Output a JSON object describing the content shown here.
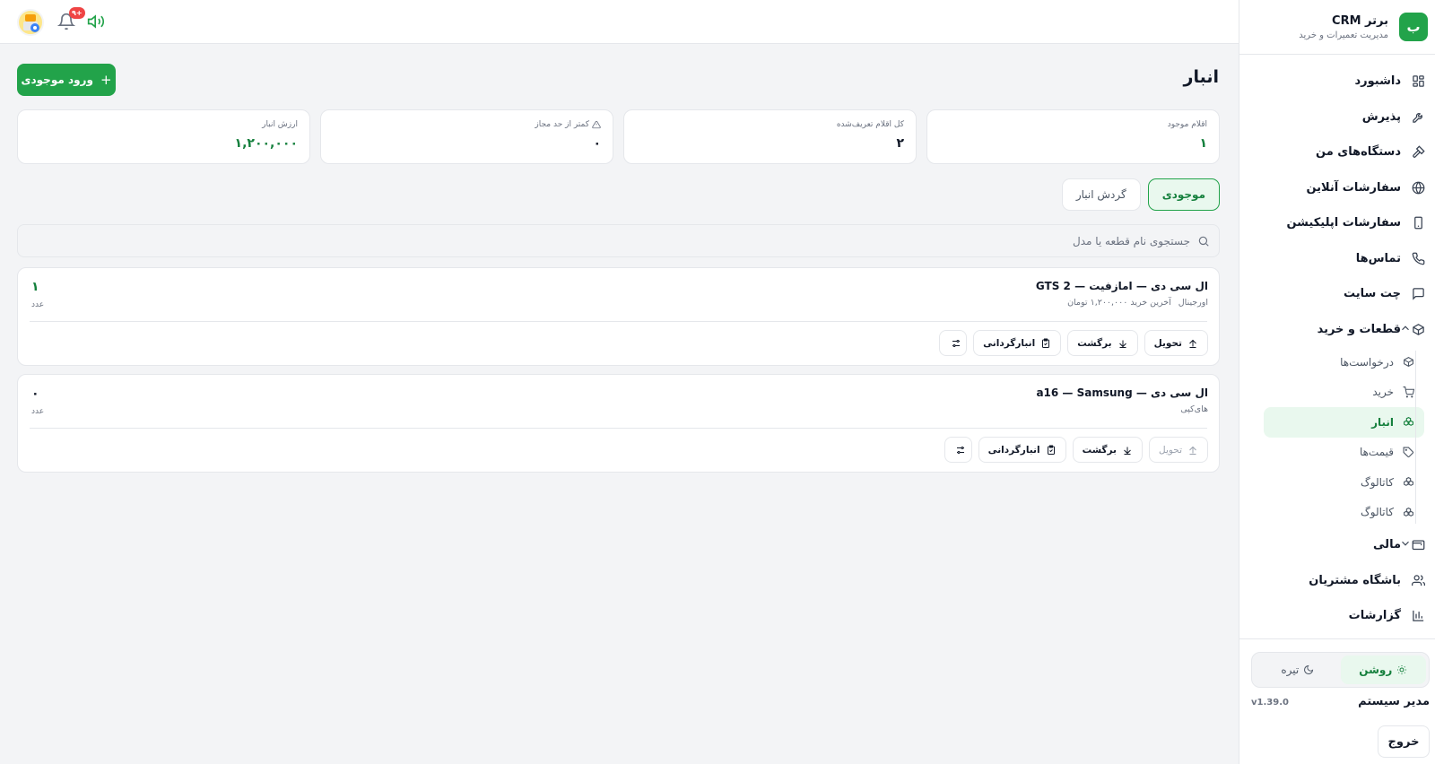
{
  "brand": {
    "logo_letter": "ب",
    "title": "برتر CRM",
    "subtitle": "مدیریت تعمیرات و خرید",
    "accent": "#22a34a"
  },
  "nav": {
    "items": [
      {
        "label": "داشبورد",
        "icon": "dashboard-icon"
      },
      {
        "label": "پذیرش",
        "icon": "wrench-icon"
      },
      {
        "label": "دستگاه‌های من",
        "icon": "hammer-icon"
      },
      {
        "label": "سفارشات آنلاین",
        "icon": "globe-icon"
      },
      {
        "label": "سفارشات اپلیکیشن",
        "icon": "smartphone-icon"
      },
      {
        "label": "تماس‌ها",
        "icon": "phone-icon"
      },
      {
        "label": "چت سایت",
        "icon": "chat-icon"
      },
      {
        "label": "قطعات و خرید",
        "icon": "package-icon",
        "expanded": true
      }
    ],
    "sub_items": [
      {
        "label": "درخواست‌ها",
        "icon": "box-icon"
      },
      {
        "label": "خرید",
        "icon": "cart-icon"
      },
      {
        "label": "انبار",
        "icon": "boxes-icon",
        "active": true
      },
      {
        "label": "قیمت‌ها",
        "icon": "tag-icon"
      },
      {
        "label": "کاتالوگ",
        "icon": "boxes-icon"
      },
      {
        "label": "کاتالوگ",
        "icon": "boxes-icon"
      }
    ],
    "after_items": [
      {
        "label": "مالی",
        "icon": "wallet-icon",
        "expanded": false
      },
      {
        "label": "باشگاه مشتریان",
        "icon": "users-icon"
      },
      {
        "label": "گزارشات",
        "icon": "chart-icon"
      }
    ]
  },
  "theme": {
    "light_label": "روشن",
    "dark_label": "تیره",
    "selected": "light"
  },
  "user": {
    "name": "مدیر سیستم",
    "version": "v1.39.0",
    "logout_label": "خروج"
  },
  "topbar": {
    "notification_count": "۹+"
  },
  "page": {
    "title": "انبار",
    "add_button_label": "ورود موجودی"
  },
  "stats": [
    {
      "label": "اقلام موجود",
      "value": "۱",
      "green": true
    },
    {
      "label": "کل اقلام تعریف‌شده",
      "value": "۲",
      "green": false
    },
    {
      "label": "کمتر از حد مجاز",
      "value": "۰",
      "green": false,
      "icon": "warning-icon"
    },
    {
      "label": "ارزش انبار",
      "value": "۱,۲۰۰,۰۰۰",
      "green": true
    }
  ],
  "tabs": [
    {
      "label": "موجودی",
      "active": true
    },
    {
      "label": "گردش انبار",
      "active": false
    }
  ],
  "search": {
    "placeholder": "جستجوی نام قطعه یا مدل",
    "value": ""
  },
  "items": [
    {
      "name": "ال سی دی — امازفیت — GTS 2",
      "meta": [
        "اورجینال",
        "آخرین خرید ۱,۲۰۰,۰۰۰ تومان"
      ],
      "qty": "۱",
      "unit": "عدد",
      "actions": {
        "deliver": "تحویل",
        "return": "برگشت",
        "stocktake": "انبارگردانی"
      },
      "deliver_enabled": true
    },
    {
      "name": "ال سی دی — a16 — Samsung",
      "meta": [
        "های‌کپی"
      ],
      "qty": "۰",
      "unit": "عدد",
      "actions": {
        "deliver": "تحویل",
        "return": "برگشت",
        "stocktake": "انبارگردانی"
      },
      "deliver_enabled": false
    }
  ]
}
